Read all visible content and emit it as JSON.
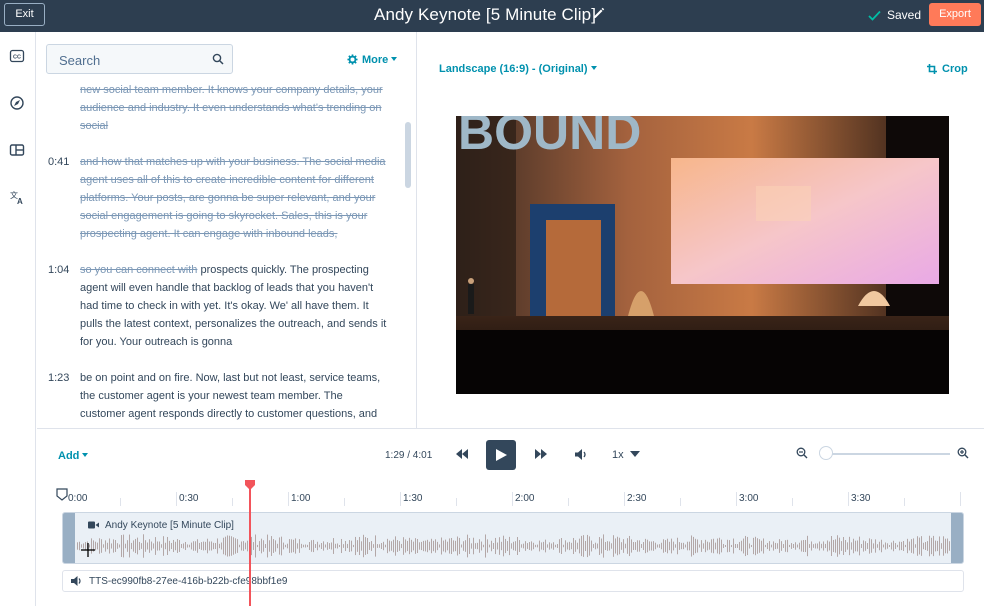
{
  "header": {
    "exit_label": "Exit",
    "title": "Andy Keynote [5 Minute Clip]",
    "saved_label": "Saved",
    "export_label": "Export"
  },
  "rail": {
    "icons": [
      "closed-captions-icon",
      "compass-icon",
      "layout-icon",
      "translate-icon"
    ]
  },
  "transcript": {
    "search_placeholder": "Search",
    "more_label": "More",
    "segments": [
      {
        "time": "",
        "struck": "new social team member. It knows your company details, your audience and industry. It even understands what's trending on social",
        "text": ""
      },
      {
        "time": "0:41",
        "struck": "and how that matches up with your business. The social media agent uses all of this to create incredible content for different platforms. Your posts, are gonna be super relevant, and your social engagement is going to skyrocket. Sales, this is your prospecting agent. It can engage with inbound leads,",
        "text": ""
      },
      {
        "time": "1:04",
        "struck": "so you can connect with",
        "text": " prospects quickly. The prospecting agent will even handle that backlog of leads that you haven't had time to check in with yet. It's okay. We' all have them. It pulls the latest context, personalizes the outreach, and sends it for you. Your outreach is gonna"
      },
      {
        "time": "1:23",
        "struck": "",
        "text": "be on point and on fire. Now, last but not least, service teams, the customer agent is your newest team member. The customer agent responds directly to customer questions, and"
      }
    ]
  },
  "preview": {
    "aspect_label": "Landscape (16:9) - (Original)",
    "crop_label": "Crop",
    "stage_text": "BOUND"
  },
  "controls": {
    "add_label": "Add",
    "time_display": "1:29 / 4:01",
    "speed_label": "1x",
    "zoom_level": 0.05
  },
  "timeline": {
    "ticks": [
      "0:00",
      "0:30",
      "1:00",
      "1:30",
      "2:00",
      "2:30",
      "3:00",
      "3:30"
    ],
    "clip_title": "Andy Keynote [5 Minute Clip]",
    "audio_track": "TTS-ec990fb8-27ee-416b-b22b-cfe98bbf1e9"
  },
  "colors": {
    "header_bg": "#2d3e50",
    "accent": "#0091ae",
    "export": "#ff7a59",
    "playhead": "#f2545b"
  }
}
